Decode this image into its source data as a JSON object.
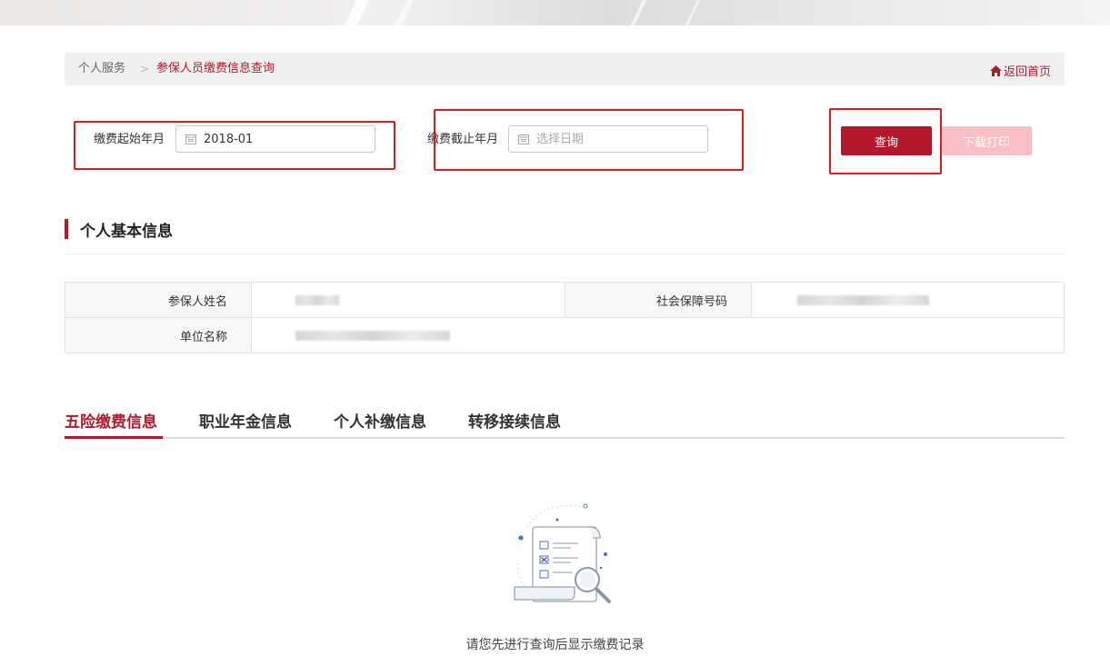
{
  "breadcrumb": {
    "items": [
      "个人服务",
      "参保人员缴费信息查询"
    ],
    "separator": ">",
    "home_link": "返回首页"
  },
  "filters": {
    "start_label": "缴费起始年月",
    "start_value": "2018-01",
    "end_label": "缴费截止年月",
    "end_placeholder": "选择日期"
  },
  "buttons": {
    "query": "查询",
    "download_print": "下载打印"
  },
  "basic_info": {
    "title": "个人基本信息",
    "fields": {
      "name_label": "参保人姓名",
      "ssn_label": "社会保障号码",
      "unit_label": "单位名称"
    }
  },
  "tabs": [
    "五险缴费信息",
    "职业年金信息",
    "个人补缴信息",
    "转移接续信息"
  ],
  "active_tab": 0,
  "empty_state": {
    "message": "请您先进行查询后显示缴费记录",
    "icon": "document-search-illustration"
  },
  "colors": {
    "accent": "#b5182b",
    "disabled_button": "#f8c0c4",
    "annotation_box": "#e01b1b"
  }
}
